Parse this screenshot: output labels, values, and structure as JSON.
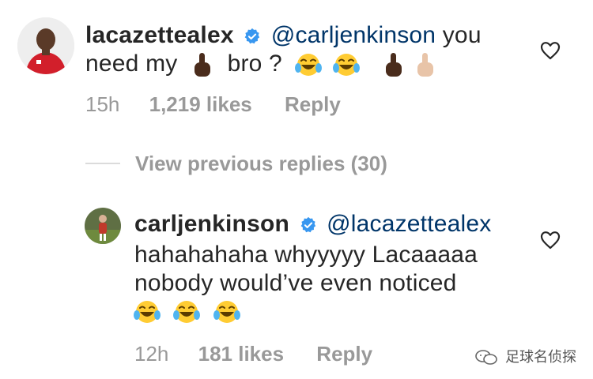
{
  "comment1": {
    "username": "lacazettealex",
    "mention": "@carljenkinson",
    "text_a": "you",
    "text_b": "need my",
    "text_c": "bro ?",
    "time": "15h",
    "likes": "1,219 likes",
    "reply": "Reply"
  },
  "view_replies": "View previous replies (30)",
  "comment2": {
    "username": "carljenkinson",
    "mention": "@lacazettealex",
    "line2": "hahahahaha whyyyyy Lacaaaaa",
    "line3": "nobody would’ve even noticed",
    "time": "12h",
    "likes": "181 likes",
    "reply": "Reply"
  },
  "watermark": "足球名侦探",
  "colors": {
    "mention": "#003569",
    "meta": "#999999",
    "verified": "#3897f0"
  },
  "icons": [
    "heart-outline-icon",
    "verified-badge-icon",
    "pointing-finger-emoji",
    "laughing-tears-emoji",
    "wechat-icon"
  ]
}
